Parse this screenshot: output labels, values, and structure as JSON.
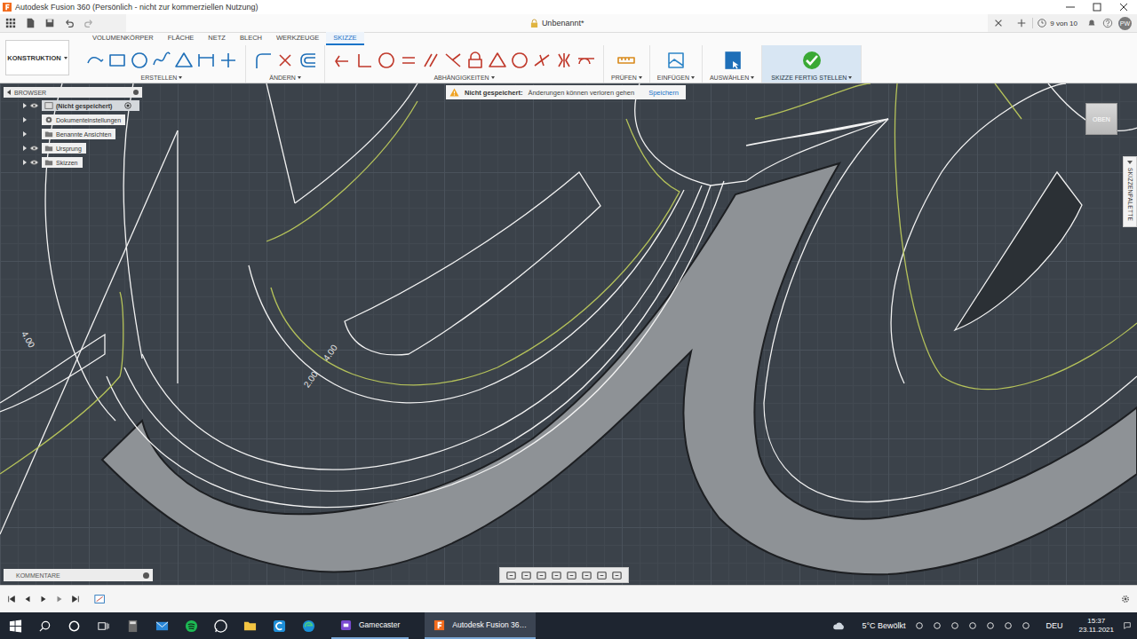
{
  "window": {
    "title": "Autodesk Fusion 360 (Persönlich - nicht zur kommerziellen Nutzung)"
  },
  "document": {
    "title": "Unbenannt*",
    "job_status": "9 von 10",
    "user": "PW"
  },
  "workspace": "KONSTRUKTION",
  "tabs": [
    {
      "label": "VOLUMENKÖRPER",
      "selected": false
    },
    {
      "label": "FLÄCHE",
      "selected": false
    },
    {
      "label": "NETZ",
      "selected": false
    },
    {
      "label": "BLECH",
      "selected": false
    },
    {
      "label": "WERKZEUGE",
      "selected": false
    },
    {
      "label": "SKIZZE",
      "selected": true
    }
  ],
  "tool_groups": [
    {
      "label": "ERSTELLEN"
    },
    {
      "label": "ÄNDERN"
    },
    {
      "label": "ABHÄNGIGKEITEN"
    },
    {
      "label": "PRÜFEN"
    },
    {
      "label": "EINFÜGEN"
    },
    {
      "label": "AUSWÄHLEN"
    },
    {
      "label": "SKIZZE FERTIG STELLEN"
    }
  ],
  "browser": {
    "title": "BROWSER",
    "items": [
      {
        "label": "(Nicht gespeichert)",
        "selected": true,
        "visible": true,
        "kind": "document"
      },
      {
        "label": "Dokumenteinstellungen",
        "selected": false,
        "visible": false,
        "kind": "settings"
      },
      {
        "label": "Benannte Ansichten",
        "selected": false,
        "visible": false,
        "kind": "folder"
      },
      {
        "label": "Ursprung",
        "selected": false,
        "visible": true,
        "kind": "folder"
      },
      {
        "label": "Skizzen",
        "selected": false,
        "visible": true,
        "kind": "folder"
      }
    ]
  },
  "warning": {
    "label": "Nicht gespeichert:",
    "message": "Änderungen können verloren gehen",
    "action": "Speichern"
  },
  "viewcube": "OBEN",
  "palette": "SKIZZENPALETTE",
  "dimensions": [
    {
      "text": "4.00"
    },
    {
      "text": "4.00"
    },
    {
      "text": "2.00"
    }
  ],
  "comments": "KOMMENTARE",
  "taskbar": {
    "apps": [
      {
        "label": "Gamecaster",
        "active": false
      },
      {
        "label": "Autodesk Fusion 36…",
        "active": true
      }
    ],
    "weather": "5°C Bewölkt",
    "language": "DEU",
    "time": "15:37",
    "date": "23.11.2021"
  }
}
